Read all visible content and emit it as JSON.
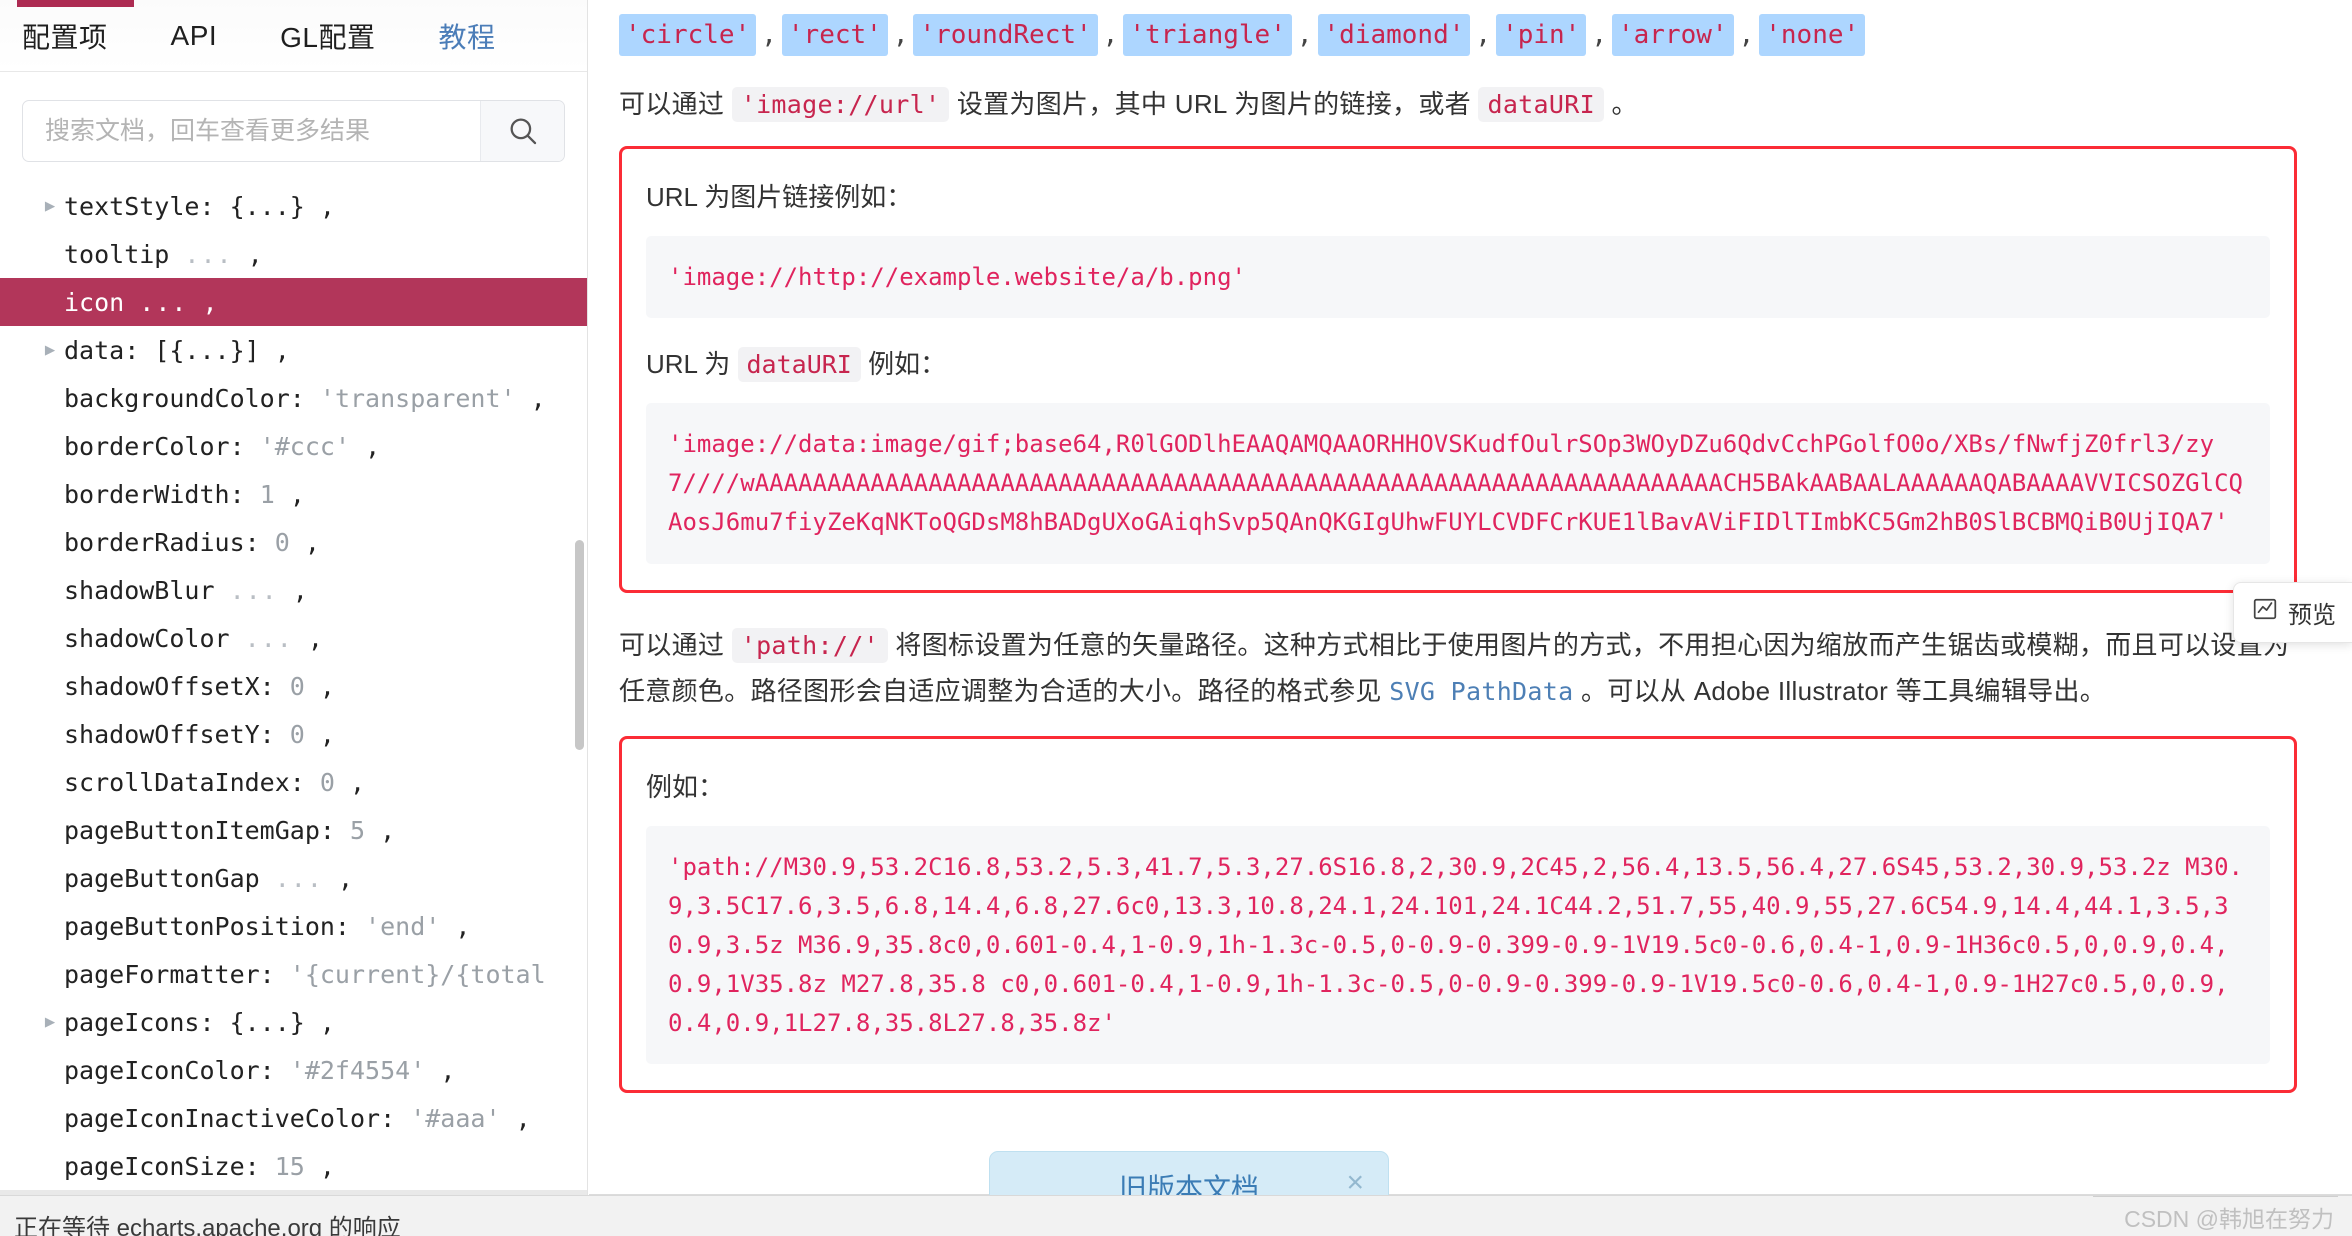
{
  "tabs": [
    {
      "label": "配置项",
      "active": true
    },
    {
      "label": "API",
      "active": false
    },
    {
      "label": "GL配置",
      "active": false
    },
    {
      "label": "教程",
      "active": false,
      "is_link": true
    }
  ],
  "search": {
    "placeholder": "搜索文档，回车查看更多结果",
    "value": "",
    "icon": "search-icon"
  },
  "tree": [
    {
      "arrow": true,
      "label": "textStyle:",
      "value": "{...}",
      "vtype": "punct",
      "comma": ",",
      "selected": false
    },
    {
      "arrow": false,
      "label": "tooltip",
      "value": "...",
      "vtype": "dots",
      "comma": ",",
      "selected": false
    },
    {
      "arrow": false,
      "label": "icon",
      "value": "...",
      "vtype": "dots",
      "comma": ",",
      "selected": true
    },
    {
      "arrow": true,
      "label": "data:",
      "value": "[{...}]",
      "vtype": "punct",
      "comma": ",",
      "selected": false
    },
    {
      "arrow": false,
      "label": "backgroundColor:",
      "value": "'transparent'",
      "vtype": "str",
      "comma": ",",
      "selected": false
    },
    {
      "arrow": false,
      "label": "borderColor:",
      "value": "'#ccc'",
      "vtype": "str",
      "comma": ",",
      "selected": false
    },
    {
      "arrow": false,
      "label": "borderWidth:",
      "value": "1",
      "vtype": "num",
      "comma": ",",
      "selected": false
    },
    {
      "arrow": false,
      "label": "borderRadius:",
      "value": "0",
      "vtype": "num",
      "comma": ",",
      "selected": false
    },
    {
      "arrow": false,
      "label": "shadowBlur",
      "value": "...",
      "vtype": "dots",
      "comma": ",",
      "selected": false
    },
    {
      "arrow": false,
      "label": "shadowColor",
      "value": "...",
      "vtype": "dots",
      "comma": ",",
      "selected": false
    },
    {
      "arrow": false,
      "label": "shadowOffsetX:",
      "value": "0",
      "vtype": "num",
      "comma": ",",
      "selected": false
    },
    {
      "arrow": false,
      "label": "shadowOffsetY:",
      "value": "0",
      "vtype": "num",
      "comma": ",",
      "selected": false
    },
    {
      "arrow": false,
      "label": "scrollDataIndex:",
      "value": "0",
      "vtype": "num",
      "comma": ",",
      "selected": false
    },
    {
      "arrow": false,
      "label": "pageButtonItemGap:",
      "value": "5",
      "vtype": "num",
      "comma": ",",
      "selected": false
    },
    {
      "arrow": false,
      "label": "pageButtonGap",
      "value": "...",
      "vtype": "dots",
      "comma": ",",
      "selected": false
    },
    {
      "arrow": false,
      "label": "pageButtonPosition:",
      "value": "'end'",
      "vtype": "str",
      "comma": ",",
      "selected": false
    },
    {
      "arrow": false,
      "label": "pageFormatter:",
      "value": "'{current}/{total",
      "vtype": "str",
      "comma": "",
      "selected": false
    },
    {
      "arrow": true,
      "label": "pageIcons:",
      "value": "{...}",
      "vtype": "punct",
      "comma": ",",
      "selected": false
    },
    {
      "arrow": false,
      "label": "pageIconColor:",
      "value": "'#2f4554'",
      "vtype": "str",
      "comma": ",",
      "selected": false
    },
    {
      "arrow": false,
      "label": "pageIconInactiveColor:",
      "value": "'#aaa'",
      "vtype": "str",
      "comma": ",",
      "selected": false
    },
    {
      "arrow": false,
      "label": "pageIconSize:",
      "value": "15",
      "vtype": "num",
      "comma": ",",
      "selected": false
    }
  ],
  "main": {
    "enum_values": [
      "'circle'",
      "'rect'",
      "'roundRect'",
      "'triangle'",
      "'diamond'",
      "'pin'",
      "'arrow'",
      "'none'"
    ],
    "intro": {
      "p1": "可以通过 ",
      "code1": "'image://url'",
      "p2": " 设置为图片，其中 URL 为图片的链接，或者 ",
      "code2": "dataURI",
      "p3": " 。"
    },
    "box1": {
      "title_url": "URL 为图片链接例如：",
      "code_url": "'image://http://example.website/a/b.png'",
      "title_datauri_pre": "URL 为 ",
      "title_datauri_code": "dataURI",
      "title_datauri_post": " 例如：",
      "code_datauri": "'image://data:image/gif;base64,R0lGODlhEAAQAMQAAORHHOVSKudfOulrSOp3WOyDZu6QdvCchPGolfO0o/XBs/fNwfjZ0frl3/zy7////wAAAAAAAAAAAAAAAAAAAAAAAAAAAAAAAAAAAAAAAAAAAAAAAAAAAAAAAAAAAAAAAAAAACH5BAkAABAALAAAAAAQABAAAAVVICSOZGlCQAosJ6mu7fiyZeKqNKToQGDsM8hBADgUXoGAiqhSvp5QAnQKGIgUhwFUYLCVDFCrKUE1lBavAViFIDlTImbKC5Gm2hB0SlBCBMQiB0UjIQA7'"
    },
    "para2": {
      "p1": "可以通过 ",
      "code1": "'path://'",
      "p2": " 将图标设置为任意的矢量路径。这种方式相比于使用图片的方式，不用担心因为缩放而产生锯齿或模糊，而且可以设置为任意颜色。路径图形会自适应调整为合适的大小。路径的格式参见 ",
      "link": "SVG PathData",
      "p3": " 。可以从 Adobe Illustrator 等工具编辑导出。"
    },
    "box2": {
      "title": "例如：",
      "code_path": "'path://M30.9,53.2C16.8,53.2,5.3,41.7,5.3,27.6S16.8,2,30.9,2C45,2,56.4,13.5,56.4,27.6S45,53.2,30.9,53.2z M30.9,3.5C17.6,3.5,6.8,14.4,6.8,27.6c0,13.3,10.8,24.1,24.101,24.1C44.2,51.7,55,40.9,55,27.6C54.9,14.4,44.1,3.5,30.9,3.5z M36.9,35.8c0,0.601-0.4,1-0.9,1h-1.3c-0.5,0-0.9-0.399-0.9-1V19.5c0-0.6,0.4-1,0.9-1H36c0.5,0,0.9,0.4,0.9,1V35.8z M27.8,35.8 c0,0.601-0.4,1-0.9,1h-1.3c-0.5,0-0.9-0.399-0.9-1V19.5c0-0.6,0.4-1,0.9-1H27c0.5,0,0.9,0.4,0.9,1L27.8,35.8L27.8,35.8z'"
    }
  },
  "preview_tab": {
    "label": "预览",
    "icon": "chart-preview-icon"
  },
  "bottom_banner": {
    "label": "旧版本文档",
    "close": "×"
  },
  "statusbar": {
    "text": "正在等待 echarts.apache.org 的响应"
  },
  "watermark": "CSDN @韩旭在努力",
  "colors": {
    "accent": "#ad2b52",
    "code_text": "#e0245e",
    "selection_bg": "#add6ff",
    "redbox_border": "#fb2c36",
    "link": "#4d7fb5"
  }
}
